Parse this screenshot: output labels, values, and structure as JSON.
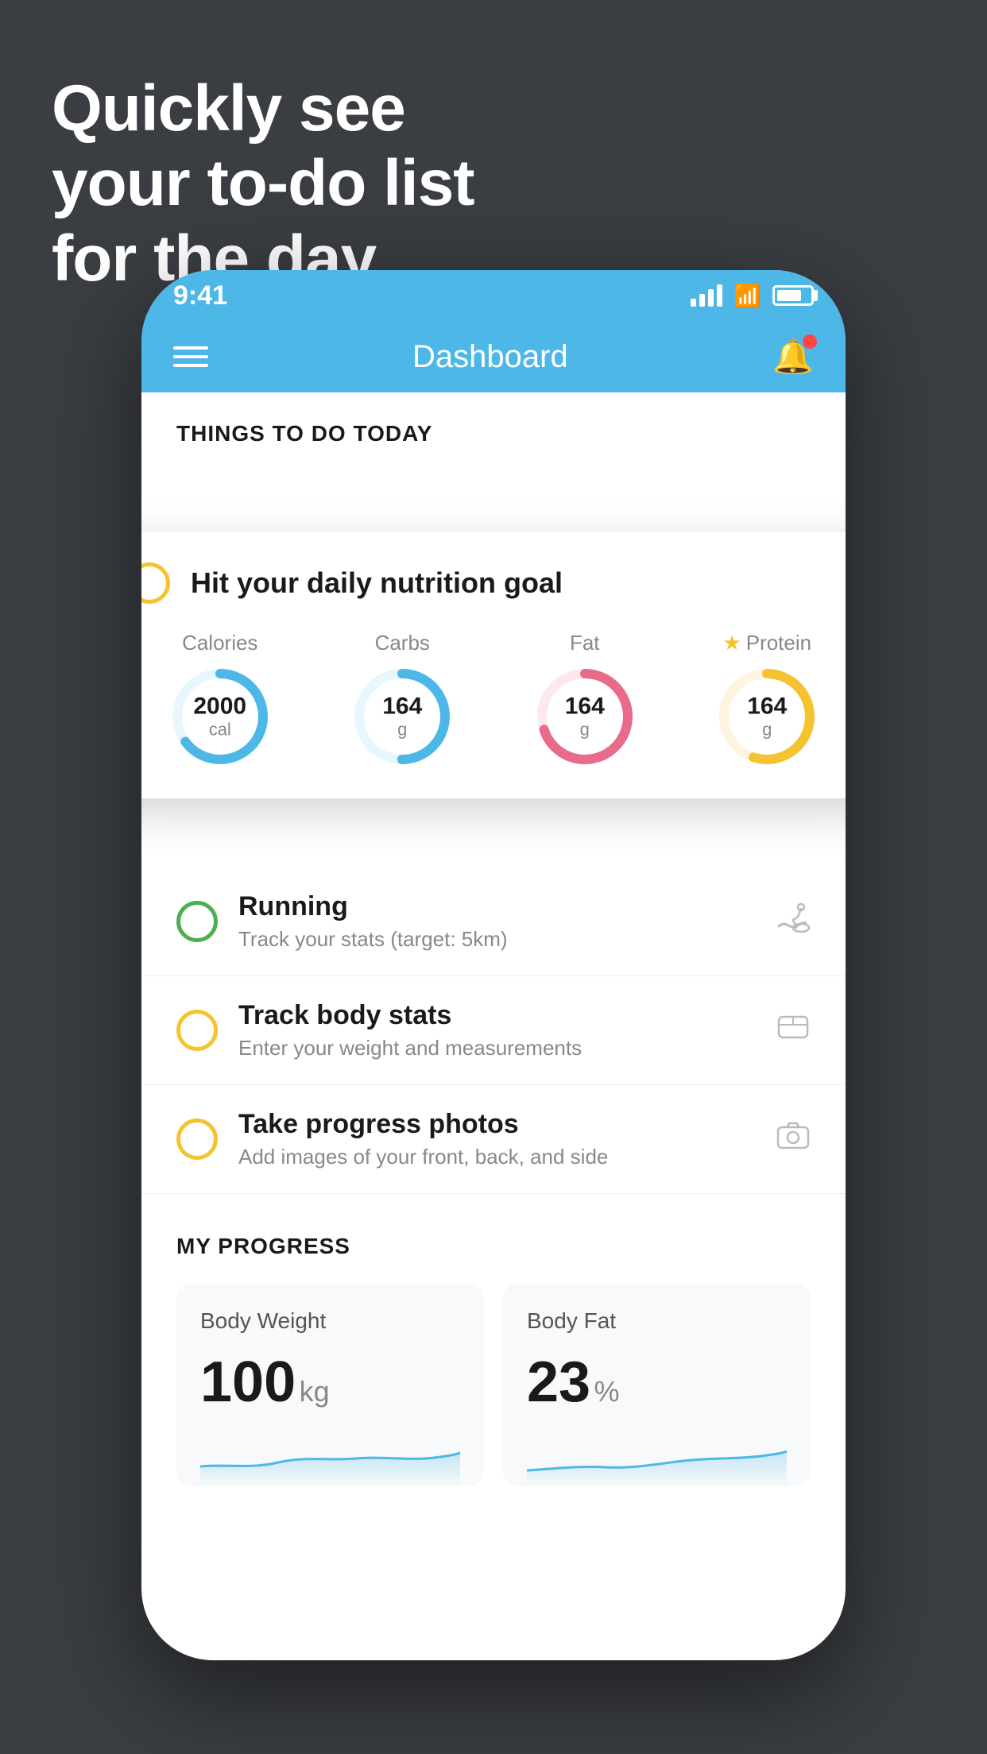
{
  "background": {
    "headline_line1": "Quickly see",
    "headline_line2": "your to-do list",
    "headline_line3": "for the day."
  },
  "status_bar": {
    "time": "9:41"
  },
  "nav": {
    "title": "Dashboard"
  },
  "content": {
    "section_title": "THINGS TO DO TODAY",
    "floating_card": {
      "title": "Hit your daily nutrition goal",
      "items": [
        {
          "label": "Calories",
          "value": "2000",
          "unit": "cal",
          "color": "#4db8e8",
          "pct": 65
        },
        {
          "label": "Carbs",
          "value": "164",
          "unit": "g",
          "color": "#4db8e8",
          "pct": 50
        },
        {
          "label": "Fat",
          "value": "164",
          "unit": "g",
          "color": "#e86b8a",
          "pct": 70
        },
        {
          "label": "Protein",
          "value": "164",
          "unit": "g",
          "color": "#f5c330",
          "pct": 55,
          "star": true
        }
      ]
    },
    "todo_items": [
      {
        "circle_color": "green",
        "title": "Running",
        "subtitle": "Track your stats (target: 5km)",
        "icon": "👟"
      },
      {
        "circle_color": "yellow",
        "title": "Track body stats",
        "subtitle": "Enter your weight and measurements",
        "icon": "⚖️"
      },
      {
        "circle_color": "yellow",
        "title": "Take progress photos",
        "subtitle": "Add images of your front, back, and side",
        "icon": "🖼️"
      }
    ],
    "progress_section": {
      "header": "MY PROGRESS",
      "cards": [
        {
          "title": "Body Weight",
          "value": "100",
          "unit": "kg"
        },
        {
          "title": "Body Fat",
          "value": "23",
          "unit": "%"
        }
      ]
    }
  }
}
